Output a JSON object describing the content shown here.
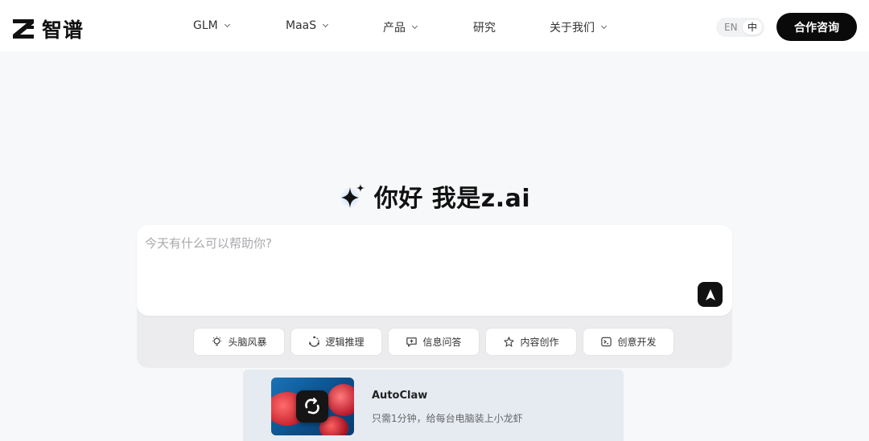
{
  "header": {
    "logo_text": "智谱",
    "logo_icon": "z-logo-icon",
    "nav": [
      {
        "label": "GLM",
        "has_dropdown": true
      },
      {
        "label": "MaaS",
        "has_dropdown": true
      },
      {
        "label": "产品",
        "has_dropdown": true
      },
      {
        "label": "研究",
        "has_dropdown": false
      },
      {
        "label": "关于我们",
        "has_dropdown": true
      }
    ],
    "lang": {
      "en": "EN",
      "zh": "中",
      "selected": "中"
    },
    "cta_label": "合作咨询"
  },
  "hero": {
    "icon": "sparkle-icon",
    "title": "你好 我是z.ai"
  },
  "chat": {
    "placeholder": "今天有什么可以帮助你?",
    "value": "",
    "send_icon": "send-arrow-icon",
    "chips": [
      {
        "label": "头脑风暴",
        "icon": "lightbulb-icon"
      },
      {
        "label": "逻辑推理",
        "icon": "reasoning-icon"
      },
      {
        "label": "信息问答",
        "icon": "chat-plus-icon"
      },
      {
        "label": "内容创作",
        "icon": "creation-icon"
      },
      {
        "label": "创意开发",
        "icon": "terminal-icon"
      }
    ]
  },
  "promo": {
    "title": "AutoClaw",
    "subtitle": "只需1分钟，给每台电脑装上小龙虾",
    "icon": "autoclaw-app-icon"
  },
  "colors": {
    "primary": "#0a0a0a",
    "page_bg": "#f7f8fa",
    "card_bg": "#ffffff",
    "promo_bg": "#e6ebf2"
  }
}
